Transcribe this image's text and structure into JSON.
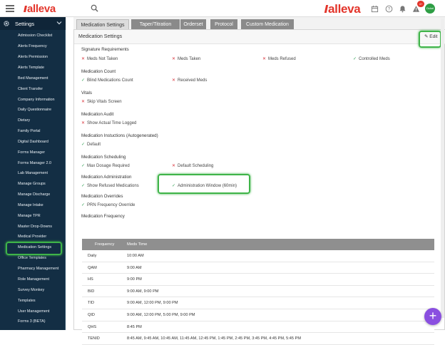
{
  "topbar": {
    "logo_left": "alleva",
    "logo_right": "alleva",
    "notification_count": "4+",
    "avatar_initials": "Ochel"
  },
  "sidebar": {
    "header": "Settings",
    "items": [
      "Admission Checklist",
      "Alerts Frequency",
      "Alerts Permission",
      "Alerts Template",
      "Bed Management",
      "Client Transfer",
      "Company Information",
      "Daily Questionnaire",
      "Dietary",
      "Family Portal",
      "Digital Dashboard",
      "Forms Manager",
      "Forms Manager 2.0",
      "Lab Management",
      "Manage Groups",
      "Manage Discharge",
      "Manage Intake",
      "Manage TPR",
      "Master Drop-Downs",
      "Medical Provider",
      "Medication Settings",
      "Office Templates",
      "Pharmacy Management",
      "Role Management",
      "Survey Monkey",
      "Templates",
      "User Management",
      "Forms 3 (BETA)"
    ]
  },
  "tabs": [
    "Medication Settings",
    "Taper/Titration",
    "Orderset",
    "Protocol",
    "Custom Medication"
  ],
  "panel": {
    "title": "Medication Settings",
    "edit_label": "Edit"
  },
  "sections": {
    "signature": {
      "label": "Signature Requirements",
      "opts": [
        {
          "text": "Meds Not Taken",
          "state": "x"
        },
        {
          "text": "Meds Taken",
          "state": "x"
        },
        {
          "text": "Meds Refused",
          "state": "x"
        },
        {
          "text": "Controlled Meds",
          "state": "check"
        }
      ]
    },
    "count": {
      "label": "Medication Count",
      "opts": [
        {
          "text": "Blind Medications Count",
          "state": "check"
        },
        {
          "text": "Received Meds",
          "state": "x"
        }
      ]
    },
    "vitals": {
      "label": "Vitals",
      "opts": [
        {
          "text": "Skip Vitals Screen",
          "state": "x"
        }
      ]
    },
    "audit": {
      "label": "Medication Audit",
      "opts": [
        {
          "text": "Show Actual Time Logged",
          "state": "x"
        }
      ]
    },
    "instructions": {
      "label": "Medication Instuctions (Autogenerated)",
      "opts": [
        {
          "text": "Default",
          "state": "check"
        }
      ]
    },
    "scheduling": {
      "label": "Medication Scheduling",
      "opts": [
        {
          "text": "Max Dosage Required",
          "state": "check"
        },
        {
          "text": "Default Scheduling",
          "state": "x"
        }
      ]
    },
    "administration": {
      "label": "Medication Administration",
      "opts": [
        {
          "text": "Show Refused Medications",
          "state": "check"
        },
        {
          "text": "Administration Window (60min)",
          "state": "check"
        }
      ]
    },
    "overrides": {
      "label": "Medication Overrides",
      "opts": [
        {
          "text": "PRN Frequency Override",
          "state": "check"
        }
      ]
    },
    "frequency": {
      "label": "Medication Frequency"
    }
  },
  "frequency_table": {
    "headers": [
      "Frequency",
      "Meds Time"
    ],
    "rows": [
      [
        "Daily",
        "10:00 AM"
      ],
      [
        "QAM",
        "9:00 AM"
      ],
      [
        "HS",
        "9:00 PM"
      ],
      [
        "BID",
        "9:00 AM, 9:00 PM"
      ],
      [
        "TID",
        "9:00 AM, 12:00 PM, 9:00 PM"
      ],
      [
        "QID",
        "9:00 AM, 12:00 PM, 5:00 PM, 9:00 PM"
      ],
      [
        "QHS",
        "8:45 PM"
      ],
      [
        "TENID",
        "8:45 AM, 9:45 AM, 10:45 AM, 11:45 AM, 12:45 PM, 1:45 PM, 2:45 PM, 3:45 PM, 4:45 PM, 5:45 PM"
      ]
    ]
  },
  "colors": {
    "brand": "#e3352b",
    "sidebar": "#132e44",
    "highlight": "#3fb449",
    "fab": "#8a4fe0"
  }
}
